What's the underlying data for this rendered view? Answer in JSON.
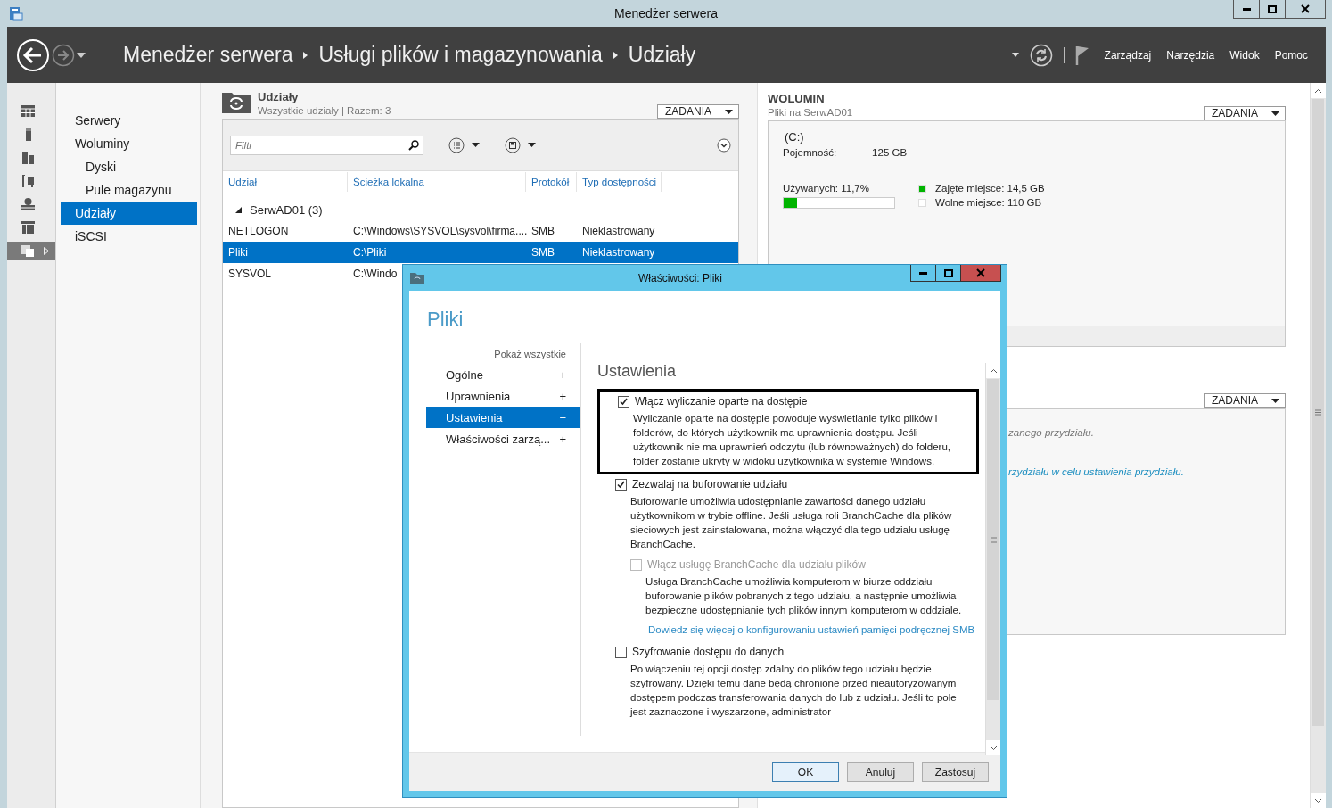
{
  "window": {
    "title": "Menedżer serwera"
  },
  "header": {
    "breadcrumbs": [
      "Menedżer serwera",
      "Usługi plików i magazynowania",
      "Udziały"
    ],
    "menu": [
      "Zarządzaj",
      "Narzędzia",
      "Widok",
      "Pomoc"
    ]
  },
  "rail": [
    {
      "selected": false
    },
    {
      "selected": false
    },
    {
      "selected": false
    },
    {
      "selected": false
    },
    {
      "selected": false
    },
    {
      "selected": false
    },
    {
      "selected": true
    }
  ],
  "nav": [
    {
      "label": "Serwery",
      "selected": false
    },
    {
      "label": "Woluminy",
      "selected": false,
      "children": [
        {
          "label": "Dyski",
          "selected": false
        },
        {
          "label": "Pule magazynu",
          "selected": false
        }
      ]
    },
    {
      "label": "Udziały",
      "selected": true
    },
    {
      "label": "iSCSI",
      "selected": false
    }
  ],
  "shares": {
    "title": "Udziały",
    "subtitle": "Wszystkie udziały | Razem: 3",
    "tasks": "ZADANIA",
    "filter_placeholder": "Filtr",
    "columns": [
      "Udział",
      "Ścieżka lokalna",
      "Protokół",
      "Typ dostępności"
    ],
    "group": {
      "label": "SerwAD01 (3)",
      "expanded": true
    },
    "rows": [
      {
        "cells": [
          "NETLOGON",
          "C:\\Windows\\SYSVOL\\sysvol\\firma....",
          "SMB",
          "Nieklastrowany"
        ],
        "selected": false
      },
      {
        "cells": [
          "Pliki",
          "C:\\Pliki",
          "SMB",
          "Nieklastrowany"
        ],
        "selected": true
      },
      {
        "cells": [
          "SYSVOL",
          "C:\\Windo"
        ],
        "selected": false
      }
    ]
  },
  "volume": {
    "title": "WOLUMIN",
    "subtitle": "Pliki na SerwAD01",
    "tasks": "ZADANIA",
    "drive": "(C:)",
    "capacity_label": "Pojemność:",
    "capacity": "125 GB",
    "used_label": "Używanych: 11,7%",
    "level": 0.117,
    "legend": [
      {
        "label": "Zajęte miejsce: 14,5 GB",
        "color": "#00b400"
      },
      {
        "label": "Wolne miejsce: 110 GB",
        "color": "#ffffff"
      }
    ]
  },
  "quota": {
    "tasks": "ZADANIA",
    "texts": [
      {
        "text": "zanego przydziału.",
        "kind": "note"
      },
      {
        "text": "rzydziału w celu ustawienia przydziału.",
        "kind": "link"
      }
    ]
  },
  "dialog": {
    "title": "Właściwości: Pliki",
    "heading": "Pliki",
    "show_all": "Pokaż wszystkie",
    "sections": [
      {
        "label": "Ogólne",
        "toggle": "+",
        "selected": false
      },
      {
        "label": "Uprawnienia",
        "toggle": "+",
        "selected": false
      },
      {
        "label": "Ustawienia",
        "toggle": "−",
        "selected": true
      },
      {
        "label": "Właściwości zarzą...",
        "toggle": "+",
        "selected": false
      }
    ],
    "settings_heading": "Ustawienia",
    "options": [
      {
        "label": "Włącz wyliczanie oparte na dostępie",
        "checked": true,
        "disabled": false,
        "highlighted": true,
        "description": "Wyliczanie oparte na dostępie powoduje wyświetlanie tylko plików i folderów, do których użytkownik ma uprawnienia dostępu. Jeśli użytkownik nie ma uprawnień odczytu (lub równoważnych) do folderu, folder zostanie ukryty w widoku użytkownika w systemie Windows."
      },
      {
        "label": "Zezwalaj na buforowanie udziału",
        "checked": true,
        "disabled": false,
        "highlighted": false,
        "description": "Buforowanie umożliwia udostępnianie zawartości danego udziału użytkownikom w trybie offline. Jeśli usługa roli BranchCache dla plików sieciowych jest zainstalowana, można włączyć dla tego udziału usługę BranchCache.",
        "children": [
          {
            "label": "Włącz usługę BranchCache dla udziału plików",
            "checked": false,
            "disabled": true,
            "highlighted": false,
            "description": "Usługa BranchCache umożliwia komputerom w biurze oddziału buforowanie plików pobranych z tego udziału, a następnie umożliwia bezpieczne udostępnianie tych plików innym komputerom w oddziale."
          }
        ],
        "link": "Dowiedz się więcej o konfigurowaniu ustawień pamięci podręcznej SMB"
      },
      {
        "label": "Szyfrowanie dostępu do danych",
        "checked": false,
        "disabled": false,
        "highlighted": false,
        "description": "Po włączeniu tej opcji dostęp zdalny do plików tego udziału będzie szyfrowany. Dzięki temu dane będą chronione przed nieautoryzowanym dostępem podczas transferowania danych do lub z udziału. Jeśli to pole jest zaznaczone i wyszarzone, administrator"
      }
    ],
    "buttons": [
      {
        "label": "OK",
        "default": true
      },
      {
        "label": "Anuluj",
        "default": false
      },
      {
        "label": "Zastosuj",
        "default": false
      }
    ]
  }
}
